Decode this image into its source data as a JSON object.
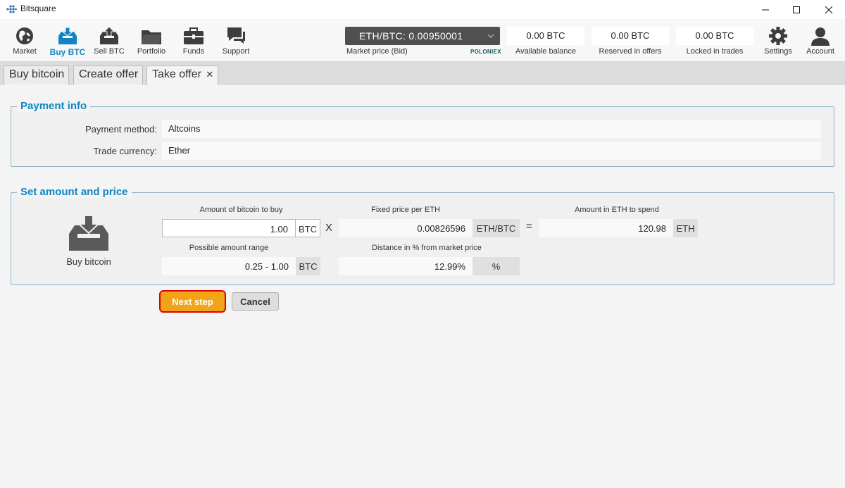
{
  "window": {
    "title": "Bitsquare",
    "minimize": "—",
    "maximize": "☐",
    "close": "✕"
  },
  "nav": {
    "items": [
      {
        "label": "Market",
        "icon": "globe-icon"
      },
      {
        "label": "Buy BTC",
        "icon": "buy-inbox-icon",
        "active": true
      },
      {
        "label": "Sell BTC",
        "icon": "sell-outbox-icon"
      },
      {
        "label": "Portfolio",
        "icon": "folder-icon"
      },
      {
        "label": "Funds",
        "icon": "briefcase-icon"
      },
      {
        "label": "Support",
        "icon": "chat-bubbles-icon"
      }
    ],
    "market_price": {
      "value": "ETH/BTC: 0.00950001",
      "caption": "Market price (Bid)",
      "provider": "POLONIEX"
    },
    "balances": [
      {
        "value": "0.00 BTC",
        "label": "Available balance"
      },
      {
        "value": "0.00 BTC",
        "label": "Reserved in offers"
      },
      {
        "value": "0.00 BTC",
        "label": "Locked in trades"
      }
    ],
    "settings_label": "Settings",
    "account_label": "Account"
  },
  "tabs": [
    {
      "label": "Buy bitcoin"
    },
    {
      "label": "Create offer"
    },
    {
      "label": "Take offer",
      "closable": true,
      "close": "✕",
      "active": true
    }
  ],
  "payment_info": {
    "title": "Payment info",
    "payment_method_label": "Payment method:",
    "payment_method_value": "Altcoins",
    "trade_currency_label": "Trade currency:",
    "trade_currency_value": "Ether"
  },
  "amount_price": {
    "title": "Set amount and price",
    "icon_label": "Buy bitcoin",
    "amount_caption": "Amount of bitcoin to buy",
    "amount_value": "1.00",
    "amount_unit": "BTC",
    "multiply_op": "X",
    "price_caption": "Fixed price per ETH",
    "price_value": "0.00826596",
    "price_unit": "ETH/BTC",
    "equals_op": "=",
    "total_caption": "Amount in ETH to spend",
    "total_value": "120.98",
    "total_unit": "ETH",
    "range_caption": "Possible amount range",
    "range_value": "0.25 - 1.00",
    "range_unit": "BTC",
    "distance_caption": "Distance in % from market price",
    "distance_value": "12.99%",
    "distance_unit": "%"
  },
  "buttons": {
    "next": "Next step",
    "cancel": "Cancel"
  },
  "colors": {
    "accent_blue": "#0f86c3",
    "next_button": "#f1a417",
    "highlight_border": "#e00000"
  }
}
